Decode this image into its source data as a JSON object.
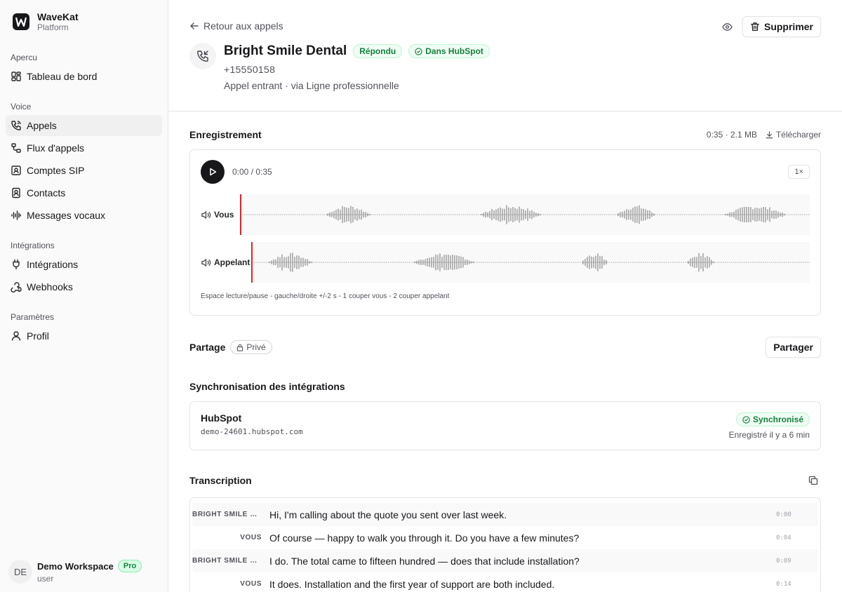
{
  "brand": {
    "name": "WaveKat",
    "sub": "Platform",
    "logo_letter": "W"
  },
  "sidebar": {
    "groups": [
      {
        "label": "Apercu",
        "items": [
          {
            "label": "Tableau de bord",
            "icon": "dashboard-icon"
          }
        ]
      },
      {
        "label": "Voice",
        "items": [
          {
            "label": "Appels",
            "icon": "phone-icon",
            "active": true
          },
          {
            "label": "Flux d'appels",
            "icon": "workflow-icon"
          },
          {
            "label": "Comptes SIP",
            "icon": "contact-card-icon"
          },
          {
            "label": "Contacts",
            "icon": "contact-book-icon"
          },
          {
            "label": "Messages vocaux",
            "icon": "audio-lines-icon"
          }
        ]
      },
      {
        "label": "Intégrations",
        "items": [
          {
            "label": "Intégrations",
            "icon": "plug-icon"
          },
          {
            "label": "Webhooks",
            "icon": "webhook-icon"
          }
        ]
      },
      {
        "label": "Paramètres",
        "items": [
          {
            "label": "Profil",
            "icon": "user-icon"
          }
        ]
      }
    ],
    "footer": {
      "initials": "DE",
      "workspace": "Demo Workspace",
      "plan": "Pro",
      "role": "user"
    }
  },
  "header": {
    "back_label": "Retour aux appels",
    "delete_label": "Supprimer",
    "title": "Bright Smile Dental",
    "status_badge": "Répondu",
    "crm_badge": "Dans HubSpot",
    "phone": "+15550158",
    "subtitle": "Appel entrant · via Ligne professionnelle"
  },
  "recording": {
    "title": "Enregistrement",
    "meta": "0:35 · 2.1 MB",
    "download_label": "Télécharger",
    "time": "0:00 / 0:35",
    "speed": "1×",
    "progress": 0,
    "tracks": [
      {
        "label": "Vous"
      },
      {
        "label": "Appelant"
      }
    ],
    "hint": "Espace lecture/pause - gauche/droite +/-2 s - 1 couper vous - 2 couper appelant",
    "colors": {
      "wave": "#8a8a8a",
      "playhead": "#dc2626"
    }
  },
  "share": {
    "title": "Partage",
    "badge": "Privé",
    "button": "Partager"
  },
  "sync": {
    "title": "Synchronisation des intégrations",
    "name": "HubSpot",
    "domain": "demo-24601.hubspot.com",
    "status": "Synchronisé",
    "time": "Enregistré il y a 6 min"
  },
  "transcript": {
    "title": "Transcription",
    "rows": [
      {
        "speaker": "BRIGHT SMILE DE...",
        "text": "Hi, I'm calling about the quote you sent over last week.",
        "time": "0:00"
      },
      {
        "speaker": "VOUS",
        "text": "Of course — happy to walk you through it. Do you have a few minutes?",
        "time": "0:04"
      },
      {
        "speaker": "BRIGHT SMILE DE...",
        "text": "I do. The total came to fifteen hundred — does that include installation?",
        "time": "0:09"
      },
      {
        "speaker": "VOUS",
        "text": "It does. Installation and the first year of support are both included.",
        "time": "0:14"
      }
    ]
  }
}
